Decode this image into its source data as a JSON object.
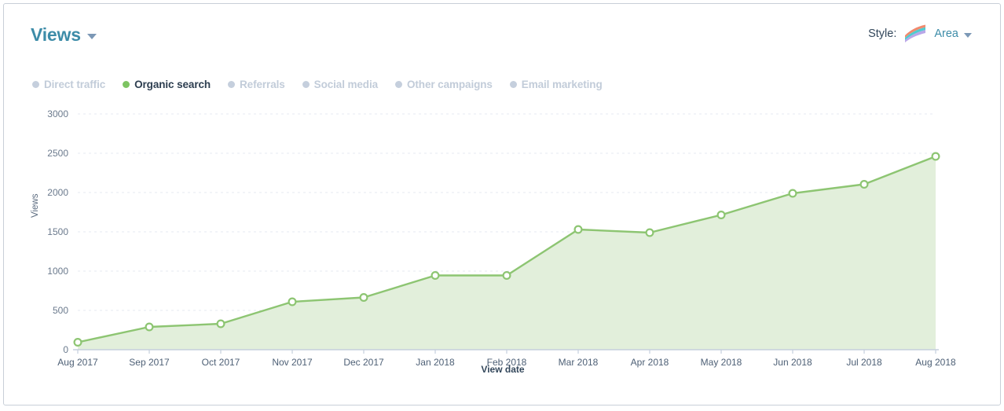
{
  "header": {
    "title": "Views",
    "title_caret_icon": "chevron-down-icon",
    "style_label": "Style:",
    "style_icon": "area-chart-icon",
    "style_value": "Area",
    "style_caret_icon": "chevron-down-icon"
  },
  "legend": {
    "items": [
      {
        "label": "Direct traffic",
        "color": "#c5cfdd",
        "active": false
      },
      {
        "label": "Organic search",
        "color": "#7dc462",
        "active": true
      },
      {
        "label": "Referrals",
        "color": "#c5cfdd",
        "active": false
      },
      {
        "label": "Social media",
        "color": "#c5cfdd",
        "active": false
      },
      {
        "label": "Other campaigns",
        "color": "#c5cfdd",
        "active": false
      },
      {
        "label": "Email marketing",
        "color": "#c5cfdd",
        "active": false
      }
    ]
  },
  "colors": {
    "accent": "#3d8ca8",
    "series_line": "#8dc572",
    "series_fill": "#e2efdb",
    "marker_stroke": "#8dc572",
    "grid": "#e6e9f0",
    "axis": "#c5cfdd",
    "text_dark": "#33475b",
    "text_muted": "#6b7a8d",
    "legend_inactive": "#c2ccd9"
  },
  "chart_data": {
    "type": "area",
    "title": "Views",
    "xlabel": "View date",
    "ylabel": "Views",
    "categories": [
      "Aug 2017",
      "Sep 2017",
      "Oct 2017",
      "Nov 2017",
      "Dec 2017",
      "Jan 2018",
      "Feb 2018",
      "Mar 2018",
      "Apr 2018",
      "May 2018",
      "Jun 2018",
      "Jul 2018",
      "Aug 2018"
    ],
    "series": [
      {
        "name": "Organic search",
        "color": "#8dc572",
        "fill": "#e2efdb",
        "values": [
          95,
          290,
          330,
          610,
          665,
          945,
          945,
          1530,
          1490,
          1715,
          1990,
          2105,
          2460
        ]
      }
    ],
    "hidden_series": [
      "Direct traffic",
      "Referrals",
      "Social media",
      "Other campaigns",
      "Email marketing"
    ],
    "ylim": [
      0,
      3000
    ],
    "yticks": [
      0,
      500,
      1000,
      1500,
      2000,
      2500,
      3000
    ],
    "ytick_labels": [
      "0",
      "500",
      "1000",
      "1500",
      "2000",
      "2500",
      "3000"
    ],
    "grid": true,
    "grid_axis": "y",
    "legend_position": "top-left"
  }
}
